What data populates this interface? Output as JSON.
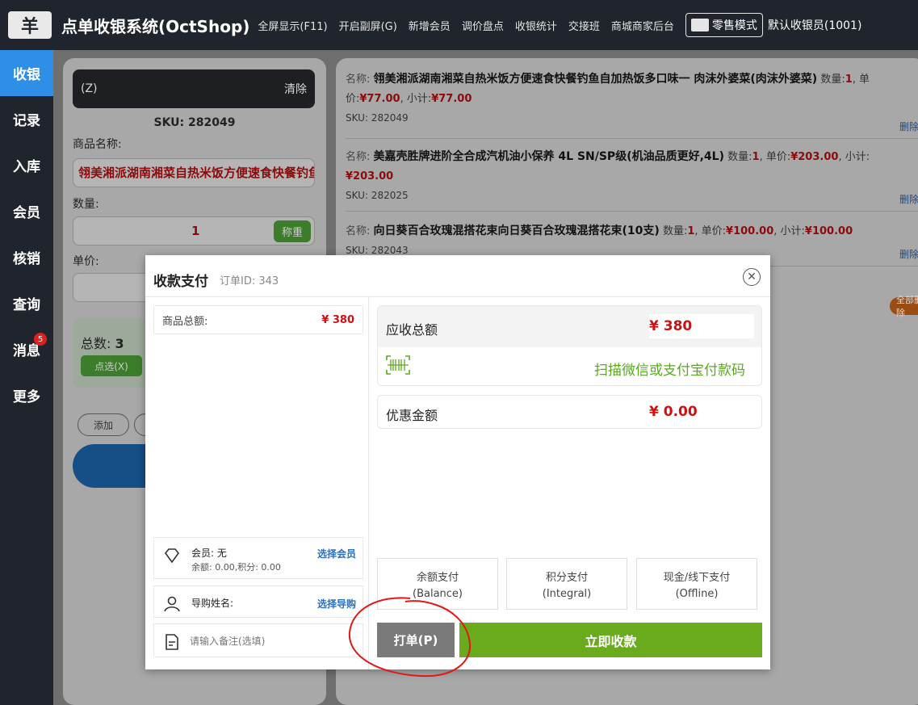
{
  "header": {
    "logo_glyph": "羊",
    "title": "点单收银系统(OctShop)",
    "nav": [
      "全屏显示(F11)",
      "开启副屏(G)",
      "新增会员",
      "调价盘点",
      "收银统计",
      "交接班",
      "商城商家后台"
    ],
    "retail_mode": "零售模式",
    "cashier": "默认收银员(1001)"
  },
  "sidebar": {
    "items": [
      {
        "label": "收银"
      },
      {
        "label": "记录"
      },
      {
        "label": "入库"
      },
      {
        "label": "会员"
      },
      {
        "label": "核销"
      },
      {
        "label": "查询"
      },
      {
        "label": "消息",
        "badge": "5"
      },
      {
        "label": "更多"
      }
    ]
  },
  "left_panel": {
    "scan_placeholder": "(Z)",
    "clear_label": "清除",
    "sku": "SKU: 282049",
    "name_label": "商品名称:",
    "name_value": "翎美湘派湖南湘菜自热米饭方便速食快餐钓鱼自加热饭多口味一 肉沫外婆菜(肉沫外婆菜)",
    "qty_label": "数量:",
    "qty_value": "1",
    "weigh_label": "称重",
    "price_label": "单价:",
    "total_label": "总数:",
    "total_value": "3",
    "select_label": "点选(X)",
    "add_label": "添加"
  },
  "cart": {
    "items": [
      {
        "name_label": "名称:",
        "name": "翎美湘派湖南湘菜自热米饭方便速食快餐钓鱼自加热饭多口味一 肉沫外婆菜(肉沫外婆菜)",
        "qty_label": "数量:",
        "qty": "1",
        "price_label": "单价:",
        "price": "¥77.00",
        "subtotal_label": "小计:",
        "subtotal": "¥77.00",
        "sku": "SKU: 282049",
        "delete": "删除"
      },
      {
        "name_label": "名称:",
        "name": "美嘉壳胜牌进阶全合成汽机油小保养 4L SN/SP级(机油品质更好,4L)",
        "qty_label": "数量:",
        "qty": "1",
        "price_label": "单价:",
        "price": "¥203.00",
        "subtotal_label": "小计:",
        "subtotal": "¥203.00",
        "sku": "SKU: 282025",
        "delete": "删除"
      },
      {
        "name_label": "名称:",
        "name": "向日葵百合玫瑰混搭花束向日葵百合玫瑰混搭花束(10支)",
        "qty_label": "数量:",
        "qty": "1",
        "price_label": "单价:",
        "price": "¥100.00",
        "subtotal_label": "小计:",
        "subtotal": "¥100.00",
        "sku": "SKU: 282043",
        "delete": "删除"
      }
    ],
    "clear_all": "全部删除"
  },
  "modal": {
    "title": "收款支付",
    "order_label": "订单ID:",
    "order_id": "343",
    "subtotal_label": "商品总额:",
    "subtotal_value": "¥ 380",
    "member_label": "会员: 无",
    "member_balance": "余额: 0.00,积分: 0.00",
    "member_link": "选择会员",
    "guide_label": "导购姓名:",
    "guide_link": "选择导购",
    "note_placeholder": "请输入备注(选填)",
    "due_label": "应收总额",
    "due_value": "¥ 380",
    "scan_text": "扫描微信或支付宝付款码",
    "discount_label": "优惠金额",
    "discount_value": "¥ 0.00",
    "pay_methods": [
      {
        "label": "余额支付",
        "sub": "(Balance)"
      },
      {
        "label": "积分支付",
        "sub": "(Integral)"
      },
      {
        "label": "现金/线下支付",
        "sub": "(Offline)"
      }
    ],
    "print_label": "打单(P)",
    "collect_label": "立即收款"
  },
  "colors": {
    "accent_blue": "#2f8fe6",
    "price_red": "#d01010",
    "pay_green": "#6aab1e",
    "annotation_red": "#e01818"
  }
}
